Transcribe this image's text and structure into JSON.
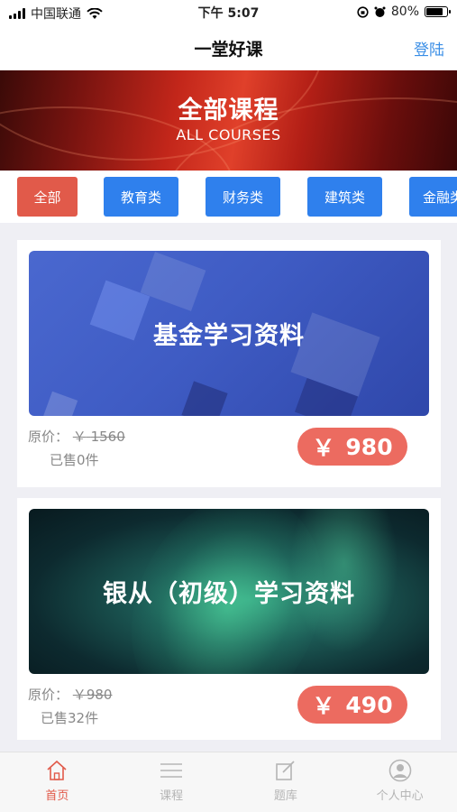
{
  "status_bar": {
    "carrier": "中国联通",
    "time": "下午 5:07",
    "battery_pct": "80%",
    "battery_level": 0.8
  },
  "nav": {
    "title": "一堂好课",
    "login_label": "登陆"
  },
  "banner": {
    "title": "全部课程",
    "subtitle": "ALL COURSES"
  },
  "categories": [
    {
      "label": "全部",
      "active": true
    },
    {
      "label": "教育类",
      "active": false
    },
    {
      "label": "财务类",
      "active": false
    },
    {
      "label": "建筑类",
      "active": false
    },
    {
      "label": "金融类",
      "active": false
    }
  ],
  "courses": [
    {
      "title": "基金学习资料",
      "original_label": "原价：",
      "original_currency": "￥",
      "original_price": "1560",
      "sold": "已售0件",
      "price_currency": "￥",
      "price": "980"
    },
    {
      "title": "银从（初级）学习资料",
      "original_label": "原价：",
      "original_currency": "￥",
      "original_price": "980",
      "sold": "已售32件",
      "price_currency": "￥",
      "price": "490"
    }
  ],
  "tabbar": [
    {
      "label": "首页",
      "icon": "home-icon",
      "active": true
    },
    {
      "label": "课程",
      "icon": "list-icon",
      "active": false
    },
    {
      "label": "题库",
      "icon": "edit-icon",
      "active": false
    },
    {
      "label": "个人中心",
      "icon": "user-icon",
      "active": false
    }
  ],
  "colors": {
    "accent_red": "#e15a4a",
    "tab_blue": "#2f80ed",
    "price_pill": "#ec6b60",
    "link_blue": "#3a8ee6"
  }
}
